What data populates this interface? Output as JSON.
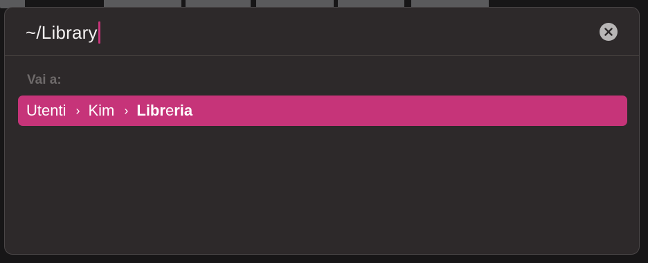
{
  "go_to_folder": {
    "path_value": "~/Library",
    "clear_icon": "close-circle-icon",
    "section_label": "Vai a:",
    "result": {
      "crumbs": [
        "Utenti",
        "Kim"
      ],
      "last_crumb_parts": [
        "Libr",
        "e",
        "ri",
        "a"
      ],
      "separator_icon": "chevron-right-icon"
    }
  },
  "colors": {
    "panel_bg": "#2d292a",
    "accent": "#c63479",
    "caret": "#c63479",
    "clear_button": "#b8b6b6",
    "label_text": "#6e6a6a"
  }
}
